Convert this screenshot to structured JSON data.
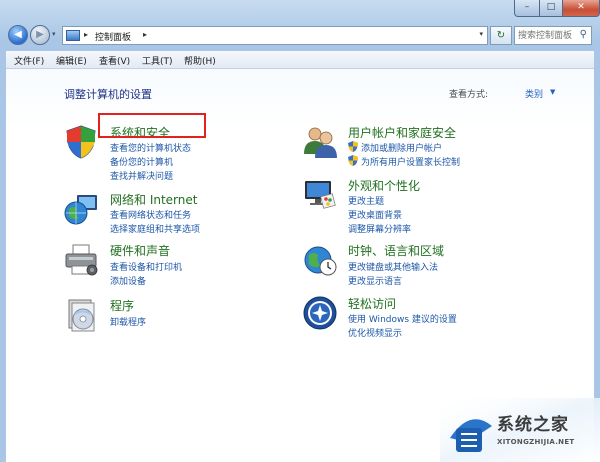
{
  "window": {
    "minimize_label": "–",
    "maximize_label": "□",
    "close_label": "✕"
  },
  "nav": {
    "back_label": "◀",
    "forward_label": "▶",
    "address_separator": "▸",
    "breadcrumb": "控制面板",
    "address_trailing_separator": "▸",
    "refresh_label": "↻",
    "search_placeholder": "搜索控制面板"
  },
  "menubar": {
    "file": "文件(F)",
    "edit": "编辑(E)",
    "view": "查看(V)",
    "tools": "工具(T)",
    "help": "帮助(H)"
  },
  "header": {
    "title": "调整计算机的设置",
    "view_by_label": "查看方式:",
    "view_by_value": "类别"
  },
  "categories": {
    "security": {
      "title": "系统和安全",
      "links": [
        "查看您的计算机状态",
        "备份您的计算机",
        "查找并解决问题"
      ]
    },
    "network": {
      "title": "网络和 Internet",
      "links": [
        "查看网络状态和任务",
        "选择家庭组和共享选项"
      ]
    },
    "hardware": {
      "title": "硬件和声音",
      "links": [
        "查看设备和打印机",
        "添加设备"
      ]
    },
    "programs": {
      "title": "程序",
      "links": [
        "卸载程序"
      ]
    },
    "accounts": {
      "title": "用户帐户和家庭安全",
      "links": [
        "添加或删除用户帐户",
        "为所有用户设置家长控制"
      ]
    },
    "appearance": {
      "title": "外观和个性化",
      "links": [
        "更改主题",
        "更改桌面背景",
        "调整屏幕分辨率"
      ]
    },
    "clock": {
      "title": "时钟、语言和区域",
      "links": [
        "更改键盘或其他输入法",
        "更改显示语言"
      ]
    },
    "ease": {
      "title": "轻松访问",
      "links": [
        "使用 Windows 建议的设置",
        "优化视频显示"
      ]
    }
  },
  "watermark": {
    "text": "系统之家",
    "url": "XITONGZHIJIA.NET"
  },
  "colors": {
    "category_title": "#207020",
    "link": "#1d57a8",
    "heading": "#1e3287",
    "highlight": "#e1231f"
  }
}
